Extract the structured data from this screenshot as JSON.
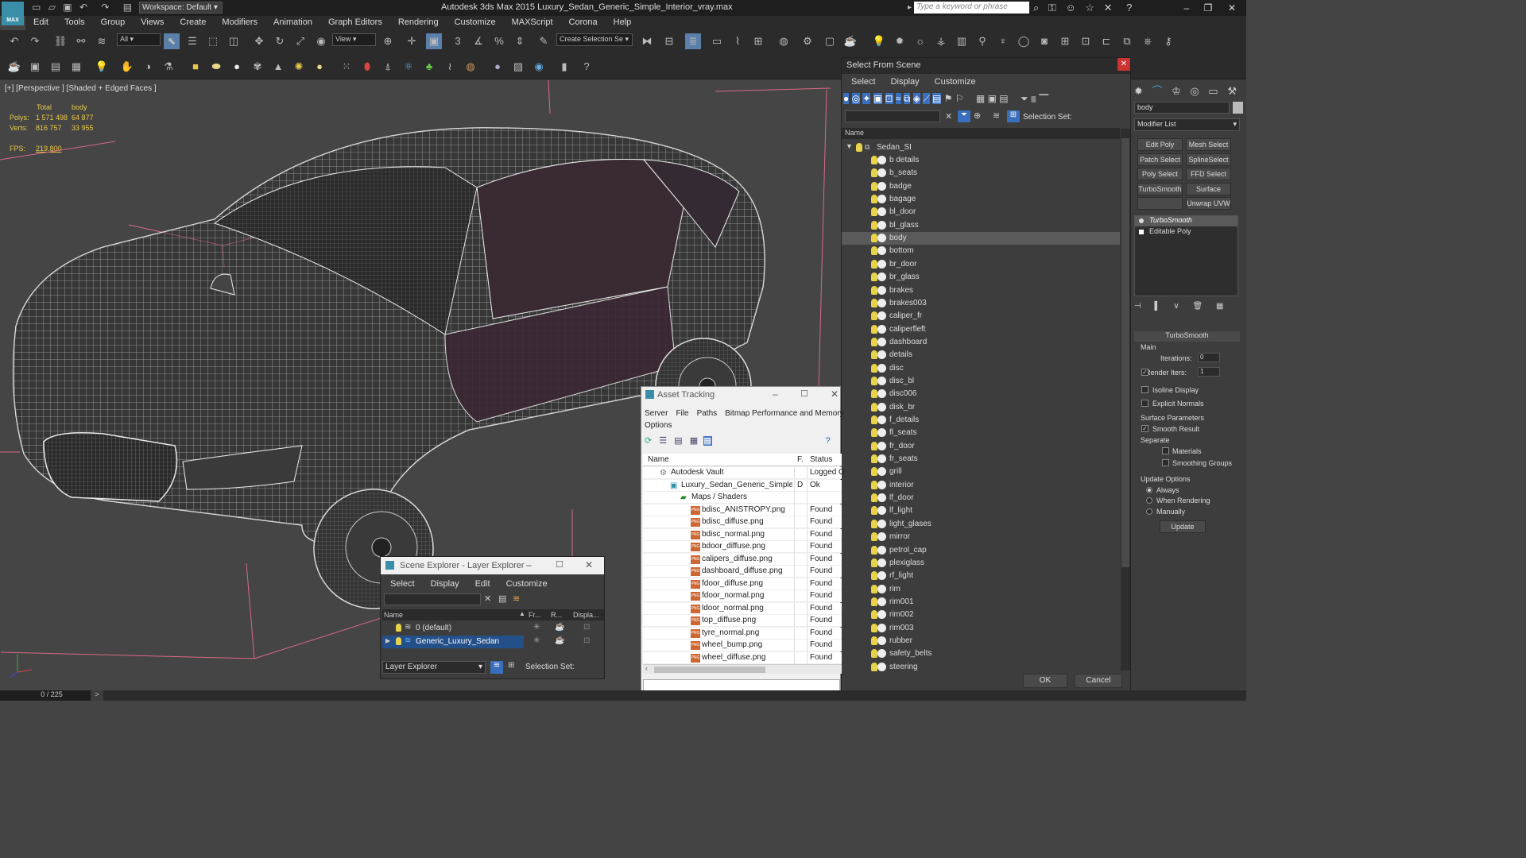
{
  "app": {
    "title": "Autodesk 3ds Max  2015     Luxury_Sedan_Generic_Simple_Interior_vray.max",
    "workspace": "Workspace: Default",
    "search_placeholder": "Type a keyword or phrase",
    "logo": "MAX"
  },
  "menu": [
    "Edit",
    "Tools",
    "Group",
    "Views",
    "Create",
    "Modifiers",
    "Animation",
    "Graph Editors",
    "Rendering",
    "Customize",
    "MAXScript",
    "Corona",
    "Help"
  ],
  "toolbar": {
    "filter_value": "All",
    "refcoord_value": "View",
    "selection_set_value": "Create Selection Se"
  },
  "viewport": {
    "label": "[+] [Perspective ] [Shaded + Edged Faces ]",
    "stats": {
      "col_total": "Total",
      "col_obj": "body",
      "polys_label": "Polys:",
      "polys_total": "1 571 498",
      "polys_obj": "64 877",
      "verts_label": "Verts:",
      "verts_total": "816 757",
      "verts_obj": "33 955",
      "fps_label": "FPS:",
      "fps_value": "219.800"
    }
  },
  "status": {
    "frames": "0 / 225",
    "next": ">"
  },
  "select_from_scene": {
    "title": "Select From Scene",
    "menu": [
      "Select",
      "Display",
      "Customize"
    ],
    "selection_set_label": "Selection Set:",
    "col_name": "Name",
    "root": "Sedan_SI",
    "items": [
      "b details",
      "b_seats",
      "badge",
      "bagage",
      "bl_door",
      "bl_glass",
      "body",
      "bottom",
      "br_door",
      "br_glass",
      "brakes",
      "brakes003",
      "caliper_fr",
      "caliperfleft",
      "dashboard",
      "details",
      "disc",
      "disc_bl",
      "disc006",
      "disk_br",
      "f_details",
      "fl_seats",
      "fr_door",
      "fr_seats",
      "grill",
      "interior",
      "lf_door",
      "lf_light",
      "light_glases",
      "mirror",
      "petrol_cap",
      "plexiglass",
      "rf_light",
      "rim",
      "rim001",
      "rim002",
      "rim003",
      "rubber",
      "safety_belts",
      "steering"
    ],
    "selected_item": "body",
    "ok_label": "OK",
    "cancel_label": "Cancel"
  },
  "command_panel": {
    "object_name": "body",
    "modifier_list": "Modifier List",
    "mod_buttons": [
      "Edit Poly",
      "Mesh Select",
      "Patch Select",
      "SplineSelect",
      "Poly Select",
      "FFD Select",
      "TurboSmooth",
      "Surface Select",
      "",
      "Unwrap UVW"
    ],
    "stack": [
      "TurboSmooth",
      "Editable Poly"
    ],
    "rollout_title": "TurboSmooth",
    "main_label": "Main",
    "iterations_label": "Iterations:",
    "iterations_value": "0",
    "render_iters_label": "Render Iters:",
    "render_iters_value": "1",
    "isoline_label": "Isoline Display",
    "explicit_normals_label": "Explicit Normals",
    "surface_params_label": "Surface Parameters",
    "smooth_result_label": "Smooth Result",
    "separate_label": "Separate",
    "materials_label": "Materials",
    "smoothing_groups_label": "Smoothing Groups",
    "update_options_label": "Update Options",
    "always_label": "Always",
    "when_rendering_label": "When Rendering",
    "manually_label": "Manually",
    "update_button": "Update"
  },
  "asset_tracking": {
    "title": "Asset Tracking",
    "menu": [
      "Server",
      "File",
      "Paths",
      "Bitmap Performance and Memory",
      "Options"
    ],
    "col_name": "Name",
    "col_flag": "F.",
    "col_status": "Status",
    "rows": [
      {
        "name": "Autodesk Vault",
        "flag": "",
        "status": "Logged O",
        "level": 1,
        "kind": "vault"
      },
      {
        "name": "Luxury_Sedan_Generic_Simple...",
        "flag": "D",
        "status": "Ok",
        "level": 2,
        "kind": "max"
      },
      {
        "name": "Maps / Shaders",
        "flag": "",
        "status": "",
        "level": 3,
        "kind": "folder"
      },
      {
        "name": "bdisc_ANISTROPY.png",
        "flag": "",
        "status": "Found",
        "level": 4,
        "kind": "png"
      },
      {
        "name": "bdisc_diffuse.png",
        "flag": "",
        "status": "Found",
        "level": 4,
        "kind": "png"
      },
      {
        "name": "bdisc_normal.png",
        "flag": "",
        "status": "Found",
        "level": 4,
        "kind": "png"
      },
      {
        "name": "bdoor_diffuse.png",
        "flag": "",
        "status": "Found",
        "level": 4,
        "kind": "png"
      },
      {
        "name": "calipers_diffuse.png",
        "flag": "",
        "status": "Found",
        "level": 4,
        "kind": "png"
      },
      {
        "name": "dashboard_diffuse.png",
        "flag": "",
        "status": "Found",
        "level": 4,
        "kind": "png"
      },
      {
        "name": "fdoor_diffuse.png",
        "flag": "",
        "status": "Found",
        "level": 4,
        "kind": "png"
      },
      {
        "name": "fdoor_normal.png",
        "flag": "",
        "status": "Found",
        "level": 4,
        "kind": "png"
      },
      {
        "name": "ldoor_normal.png",
        "flag": "",
        "status": "Found",
        "level": 4,
        "kind": "png"
      },
      {
        "name": "top_diffuse.png",
        "flag": "",
        "status": "Found",
        "level": 4,
        "kind": "png"
      },
      {
        "name": "tyre_normal.png",
        "flag": "",
        "status": "Found",
        "level": 4,
        "kind": "png"
      },
      {
        "name": "wheel_bump.png",
        "flag": "",
        "status": "Found",
        "level": 4,
        "kind": "png"
      },
      {
        "name": "wheel_diffuse.png",
        "flag": "",
        "status": "Found",
        "level": 4,
        "kind": "png"
      }
    ]
  },
  "scene_explorer": {
    "title": "Scene Explorer - Layer Explorer",
    "menu": [
      "Select",
      "Display",
      "Edit",
      "Customize"
    ],
    "col_name": "Name",
    "col_fr": "Fr...",
    "col_r": "R...",
    "col_disp": "Displa...",
    "rows": [
      {
        "name": "0 (default)",
        "selected": false
      },
      {
        "name": "Generic_Luxury_Sedan",
        "selected": true
      }
    ],
    "explorer_type": "Layer Explorer",
    "selection_set_label": "Selection Set:"
  }
}
